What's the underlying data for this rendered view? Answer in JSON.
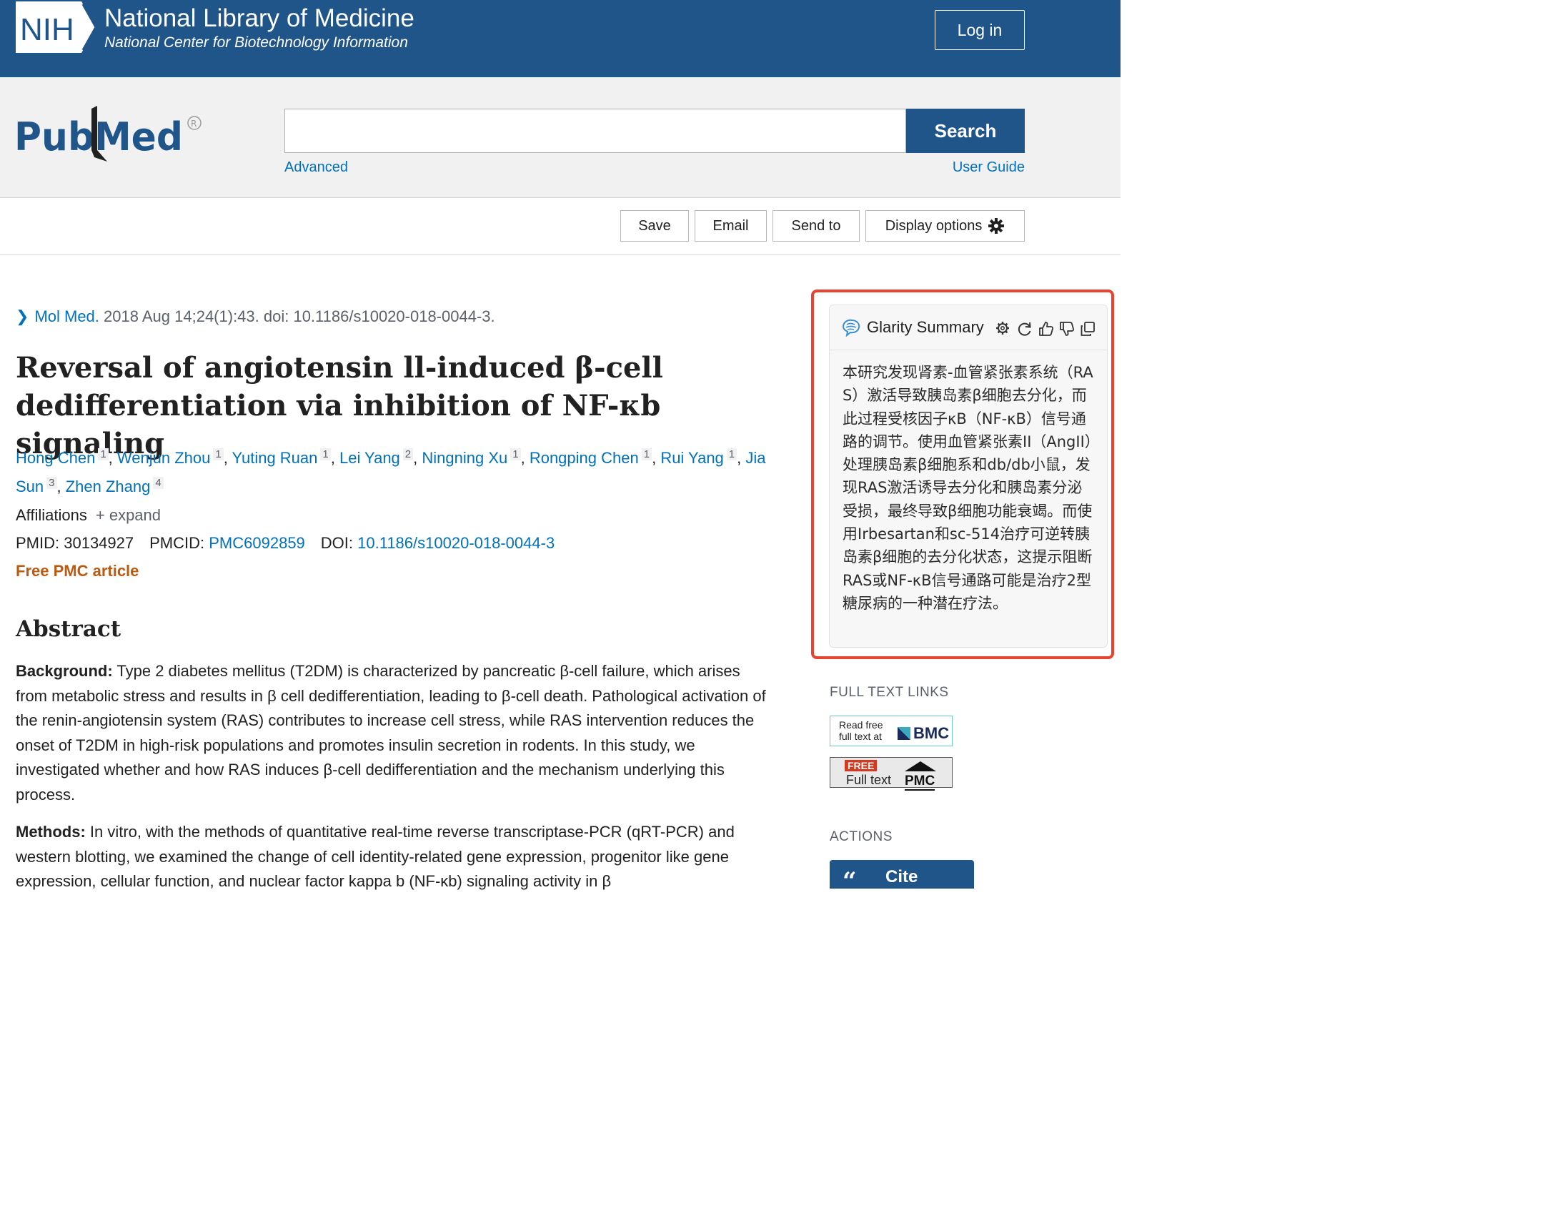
{
  "header": {
    "logo_text": "NIH",
    "title": "National Library of Medicine",
    "subtitle": "National Center for Biotechnology Information",
    "login_label": "Log in"
  },
  "search": {
    "brand": "PubMed",
    "value": "",
    "placeholder": "",
    "button_label": "Search",
    "advanced_label": "Advanced",
    "user_guide_label": "User Guide"
  },
  "toolbar": {
    "save_label": "Save",
    "email_label": "Email",
    "send_to_label": "Send to",
    "display_options_label": "Display options"
  },
  "article": {
    "journal": "Mol Med.",
    "citation": " 2018 Aug 14;24(1):43. doi: 10.1186/s10020-018-0044-3.",
    "title": "Reversal of angiotensin ll-induced β-cell dedifferentiation via inhibition of NF-κb signaling",
    "authors": [
      {
        "name": "Hong Chen",
        "aff": "1"
      },
      {
        "name": "Wenjun Zhou",
        "aff": "1"
      },
      {
        "name": "Yuting Ruan",
        "aff": "1"
      },
      {
        "name": "Lei Yang",
        "aff": "2"
      },
      {
        "name": "Ningning Xu",
        "aff": "1"
      },
      {
        "name": "Rongping Chen",
        "aff": "1"
      },
      {
        "name": "Rui Yang",
        "aff": "1"
      },
      {
        "name": "Jia Sun",
        "aff": "3"
      },
      {
        "name": "Zhen Zhang",
        "aff": "4"
      }
    ],
    "affiliations_label": "Affiliations",
    "expand_label": "+ expand",
    "pmid_label": "PMID: ",
    "pmid": "30134927",
    "pmcid_label": "PMCID: ",
    "pmcid": "PMC6092859",
    "doi_label": "DOI: ",
    "doi": "10.1186/s10020-018-0044-3",
    "free_pmc_label": "Free PMC article"
  },
  "abstract": {
    "heading": "Abstract",
    "background_label": "Background:",
    "background_text": " Type 2 diabetes mellitus (T2DM) is characterized by pancreatic β-cell failure, which arises from metabolic stress and results in β cell dedifferentiation, leading to β-cell death. Pathological activation of the renin-angiotensin system (RAS) contributes to increase cell stress, while RAS intervention reduces the onset of T2DM in high-risk populations and promotes insulin secretion in rodents. In this study, we investigated whether and how RAS induces β-cell dedifferentiation and the mechanism underlying this process.",
    "methods_label": "Methods:",
    "methods_text": " In vitro, with the methods of quantitative real-time reverse transcriptase-PCR (qRT-PCR) and western blotting, we examined the change of cell identity-related gene expression, progenitor like gene expression, cellular function, and nuclear factor kappa b (NF-κb) signaling activity in β"
  },
  "glarity": {
    "title": "Glarity Summary",
    "summary": "本研究发现肾素-血管紧张素系统（RAS）激活导致胰岛素β细胞去分化，而此过程受核因子κB（NF-κB）信号通路的调节。使用血管紧张素II（AngII）处理胰岛素β细胞系和db/db小鼠，发现RAS激活诱导去分化和胰岛素分泌受损，最终导致β细胞功能衰竭。而使用Irbesartan和sc-514治疗可逆转胰岛素β细胞的去分化状态，这提示阻断RAS或NF-κB信号通路可能是治疗2型糖尿病的一种潜在疗法。",
    "icons": [
      "settings-icon",
      "refresh-icon",
      "thumbs-up-icon",
      "thumbs-down-icon",
      "copy-icon"
    ]
  },
  "sidebar": {
    "full_text_heading": "FULL TEXT LINKS",
    "bmc_read_line1": "Read free",
    "bmc_read_line2": "full text at",
    "bmc_brand": "BMC",
    "pmc_free": "FREE",
    "pmc_fulltext": "Full text",
    "pmc_brand": "PMC",
    "actions_heading": "ACTIONS",
    "cite_label": "Cite"
  },
  "colors": {
    "nih_blue": "#20558a",
    "link_blue": "#0071bc",
    "free_orange": "#bd5a10",
    "highlight_red": "#e8432f"
  }
}
